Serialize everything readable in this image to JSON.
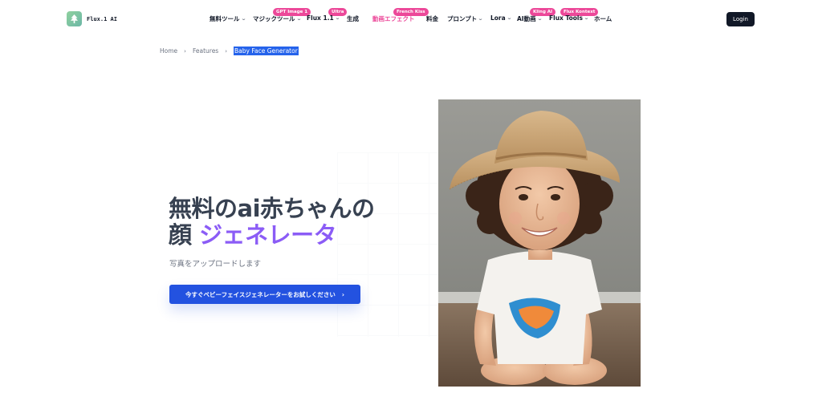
{
  "logo": {
    "text": "Flux.1 AI"
  },
  "nav": {
    "items": [
      {
        "label": "無料ツール",
        "chevron": true
      },
      {
        "label": "マジックツール",
        "chevron": true,
        "badge": "GPT Image 1"
      },
      {
        "label": "Flux 1.1",
        "chevron": true,
        "badge": "Ultra"
      },
      {
        "label": "生成",
        "chevron": false
      },
      {
        "label": "動画エフェクト",
        "chevron": false,
        "badge": "French Kiss"
      },
      {
        "label": "料金",
        "chevron": false
      },
      {
        "label": "プロンプト",
        "chevron": true
      },
      {
        "label": "Lora",
        "chevron": true
      },
      {
        "label": "AI動画",
        "chevron": true,
        "badge": "Kling AI"
      },
      {
        "label": "Flux Tools",
        "chevron": true,
        "badge": "Flux Kontext"
      },
      {
        "label": "ホーム",
        "chevron": false
      }
    ],
    "login_label": "Login"
  },
  "breadcrumb": {
    "home": "Home",
    "features": "Features",
    "current": "Baby Face Generator",
    "separator": "›"
  },
  "hero": {
    "title_line1": "無料のai赤ちゃんの",
    "title_line2_prefix": "顔 ",
    "title_line2_accent": "ジェネレータ",
    "subtitle": "写真をアップロードします",
    "cta_label": "今すぐベビーフェイスジェネレーターをお試しください",
    "cta_icon": "chevron-right-icon",
    "cta_arrow": "›"
  },
  "photo": {
    "subject": "smiling-child-in-straw-hat"
  },
  "colors": {
    "accent_purple": "#8b5cf6",
    "badge_pink": "#ec4899",
    "cta_blue": "#2352e0",
    "login_dark": "#111827"
  }
}
